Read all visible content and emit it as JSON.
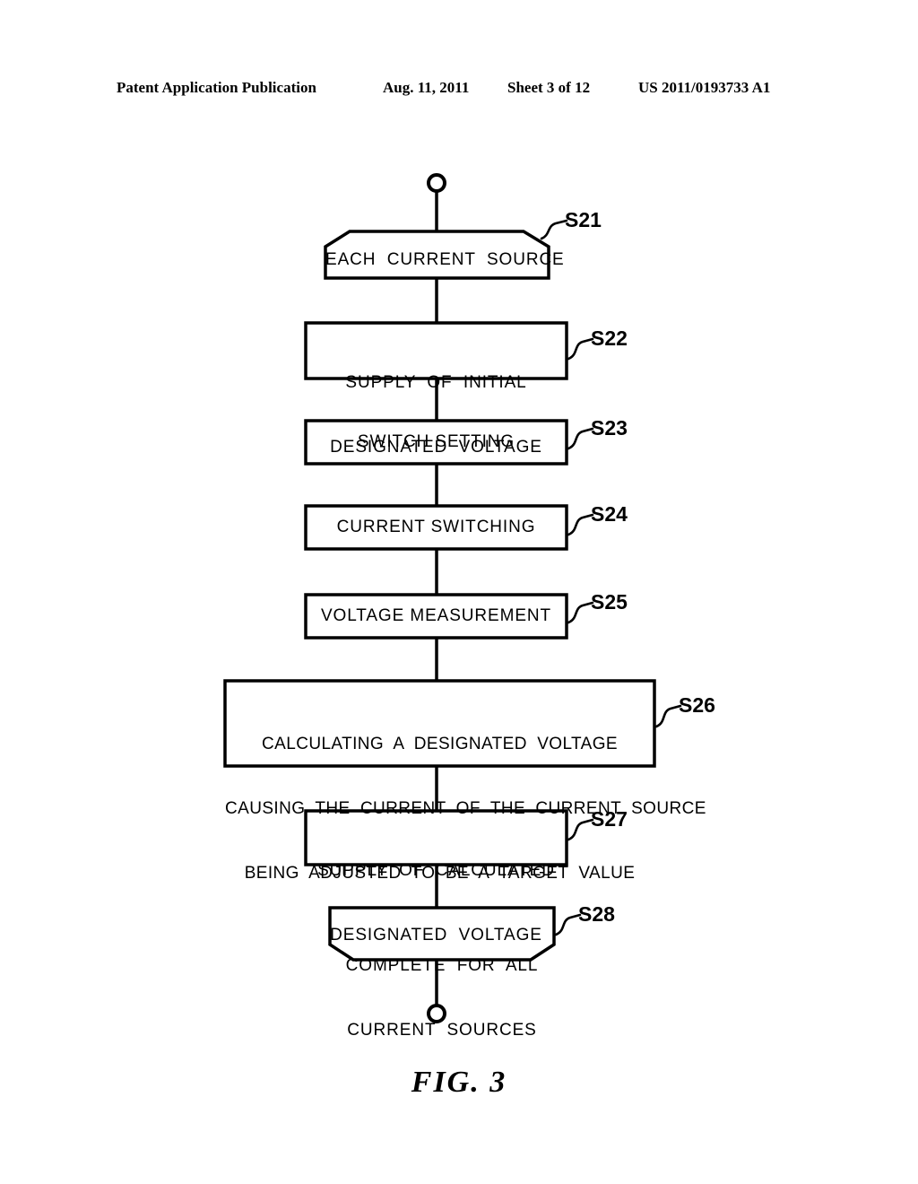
{
  "header": {
    "publication": "Patent Application Publication",
    "date": "Aug. 11, 2011",
    "sheet": "Sheet 3 of 12",
    "document_number": "US 2011/0193733 A1"
  },
  "figure": {
    "caption": "FIG. 3",
    "start_terminal": "start-node",
    "end_terminal": "end-node",
    "nodes": [
      {
        "id": "S21",
        "label": "S21",
        "shape": "hexagon-loop-start",
        "lines": [
          "EACH  CURRENT  SOURCE"
        ],
        "text": "EACH  CURRENT  SOURCE"
      },
      {
        "id": "S22",
        "label": "S22",
        "shape": "rectangle",
        "lines": [
          "SUPPLY  OF  INITIAL",
          "DESIGNATED  VOLTAGE"
        ],
        "text": "SUPPLY OF INITIAL DESIGNATED VOLTAGE"
      },
      {
        "id": "S23",
        "label": "S23",
        "shape": "rectangle",
        "lines": [
          "SWITCH  SETTING"
        ],
        "text": "SWITCH SETTING"
      },
      {
        "id": "S24",
        "label": "S24",
        "shape": "rectangle",
        "lines": [
          "CURRENT  SWITCHING"
        ],
        "text": "CURRENT SWITCHING"
      },
      {
        "id": "S25",
        "label": "S25",
        "shape": "rectangle",
        "lines": [
          "VOLTAGE  MEASUREMENT"
        ],
        "text": "VOLTAGE MEASUREMENT"
      },
      {
        "id": "S26",
        "label": "S26",
        "shape": "rectangle",
        "lines": [
          "CALCULATING  A  DESIGNATED  VOLTAGE",
          "CAUSING  THE  CURRENT  OF  THE  CURRENT  SOURCE",
          "BEING  ADJUSTED  TO  BE  A  TARGET  VALUE"
        ],
        "text": "CALCULATING A DESIGNATED VOLTAGE CAUSING THE CURRENT OF THE CURRENT SOURCE BEING ADJUSTED TO BE A TARGET VALUE"
      },
      {
        "id": "S27",
        "label": "S27",
        "shape": "rectangle",
        "lines": [
          "SUPPLY  OF  CALCULATED",
          "DESIGNATED  VOLTAGE"
        ],
        "text": "SUPPLY OF CALCULATED DESIGNATED VOLTAGE"
      },
      {
        "id": "S28",
        "label": "S28",
        "shape": "hexagon-loop-end",
        "lines": [
          "COMPLETE  FOR  ALL",
          "CURRENT  SOURCES"
        ],
        "text": "COMPLETE FOR ALL CURRENT SOURCES"
      }
    ],
    "line_color": "#000000",
    "background_color": "#ffffff"
  }
}
